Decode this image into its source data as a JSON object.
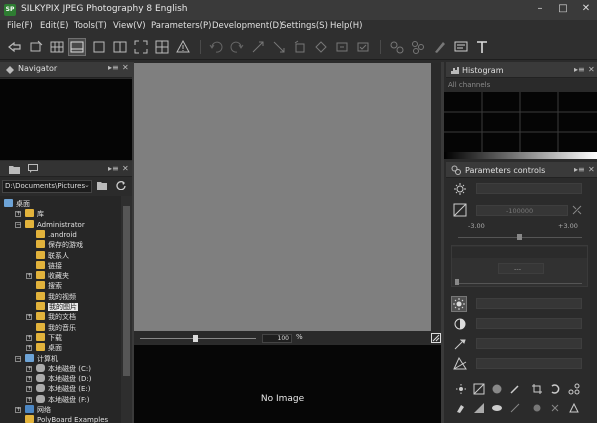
{
  "window": {
    "logo": "SP",
    "title": "SILKYPIX JPEG Photography 8 English",
    "controls": [
      "–",
      "□",
      "✕"
    ]
  },
  "menu": [
    "File(F)",
    "Edit(E)",
    "Tools(T)",
    "View(V)",
    "Parameters(P)",
    "Development(D)",
    "Settings(S)",
    "Help(H)"
  ],
  "panels": {
    "navigator": {
      "title": "Navigator",
      "controls": [
        "▸≡",
        "✕"
      ]
    },
    "browser": {
      "controls": [
        "▸≡",
        "✕"
      ]
    },
    "histogram": {
      "title": "Histogram",
      "controls": [
        "▸≡",
        "✕"
      ],
      "channel": "All channels"
    },
    "parameters": {
      "title": "Parameters controls",
      "controls": [
        "▸≡",
        "✕"
      ]
    }
  },
  "browser": {
    "path": "D:\\Documents\\Pictures",
    "path_arrow": "⌄",
    "tree": [
      {
        "label": "桌面",
        "icon": "desktop",
        "indent": 0,
        "expander": ""
      },
      {
        "label": "库",
        "icon": "folder",
        "indent": 1,
        "expander": "+"
      },
      {
        "label": "Administrator",
        "icon": "folder",
        "indent": 1,
        "expander": "−"
      },
      {
        "label": ".android",
        "icon": "folder",
        "indent": 2,
        "expander": ""
      },
      {
        "label": "保存的游戏",
        "icon": "folder",
        "indent": 2,
        "expander": ""
      },
      {
        "label": "联系人",
        "icon": "folder",
        "indent": 2,
        "expander": ""
      },
      {
        "label": "链接",
        "icon": "folder",
        "indent": 2,
        "expander": ""
      },
      {
        "label": "收藏夹",
        "icon": "folder",
        "indent": 2,
        "expander": "+"
      },
      {
        "label": "搜索",
        "icon": "folder",
        "indent": 2,
        "expander": ""
      },
      {
        "label": "我的视频",
        "icon": "folder",
        "indent": 2,
        "expander": ""
      },
      {
        "label": "我的图片",
        "icon": "folder",
        "indent": 2,
        "expander": "",
        "selected": true
      },
      {
        "label": "我的文档",
        "icon": "folder",
        "indent": 2,
        "expander": "+"
      },
      {
        "label": "我的音乐",
        "icon": "folder",
        "indent": 2,
        "expander": ""
      },
      {
        "label": "下载",
        "icon": "folder",
        "indent": 2,
        "expander": "+"
      },
      {
        "label": "桌面",
        "icon": "folder",
        "indent": 2,
        "expander": "+"
      },
      {
        "label": "计算机",
        "icon": "computer",
        "indent": 1,
        "expander": "−"
      },
      {
        "label": "本地磁盘 (C:)",
        "icon": "drive",
        "indent": 2,
        "expander": "+"
      },
      {
        "label": "本地磁盘 (D:)",
        "icon": "drive",
        "indent": 2,
        "expander": "+"
      },
      {
        "label": "本地磁盘 (E:)",
        "icon": "drive",
        "indent": 2,
        "expander": "+"
      },
      {
        "label": "本地磁盘 (F:)",
        "icon": "drive",
        "indent": 2,
        "expander": "+"
      },
      {
        "label": "网络",
        "icon": "network",
        "indent": 1,
        "expander": "+"
      },
      {
        "label": "PolyBoard Examples",
        "icon": "folder",
        "indent": 1,
        "expander": ""
      }
    ]
  },
  "viewer": {
    "zoom_value": "100",
    "zoom_unit": "%",
    "zoom_fraction": 0.5,
    "filmstrip_empty": "No Image"
  },
  "parameters": {
    "exposure_value": "-100000",
    "exposure_min": "-3.00",
    "exposure_max": "+3.00",
    "mid_value": "---"
  },
  "colors": {
    "background": "#2b2b2b",
    "canvas": "#7f7f7f",
    "panel_header": "#3a3a3a",
    "folder": "#e2b33c",
    "selection": "#e8e8e8",
    "logo": "#2e7d32"
  }
}
